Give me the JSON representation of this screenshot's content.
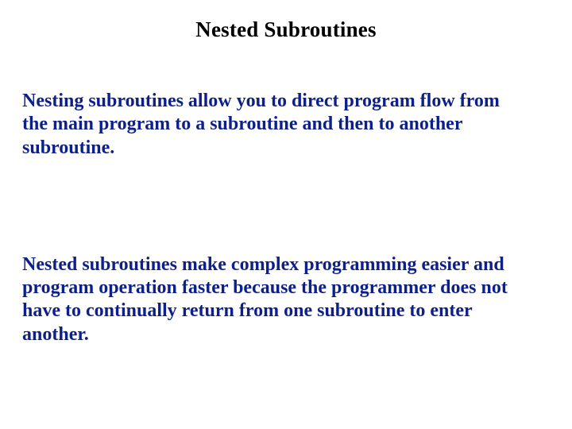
{
  "title": "Nested Subroutines",
  "paragraph1": "Nesting subroutines allow you to direct program flow from the main program to a subroutine and then to another subroutine.",
  "paragraph2": "Nested subroutines make complex programming easier and program operation faster because the programmer does not have to continually return from one subroutine to enter another."
}
